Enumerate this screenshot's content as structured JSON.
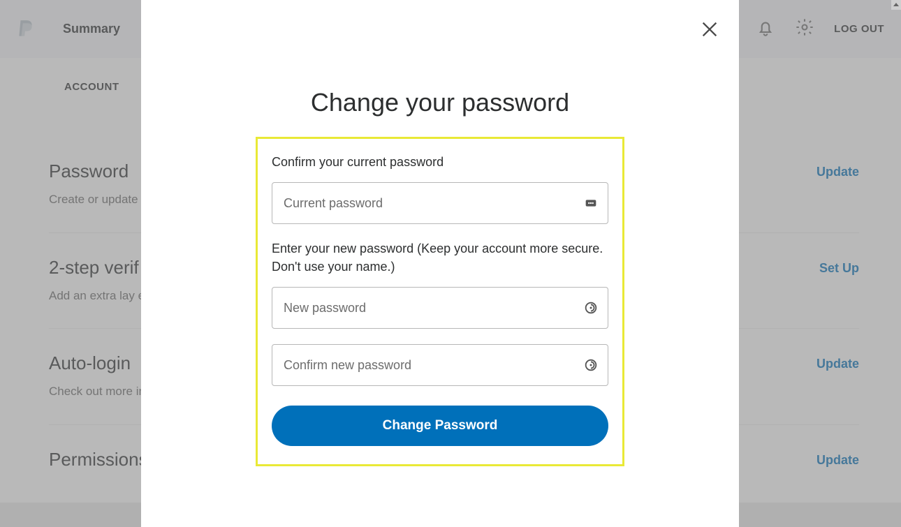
{
  "header": {
    "nav_summary": "Summary",
    "logout": "LOG OUT"
  },
  "subnav": {
    "account": "ACCOUNT"
  },
  "sections": {
    "password": {
      "title": "Password",
      "desc": "Create or update",
      "action": "Update"
    },
    "twostep": {
      "title": "2-step verif",
      "desc": "Add an extra lay\neach time you lo",
      "action": "Set Up"
    },
    "autologin": {
      "title": "Auto-login",
      "desc": "Check out more\nincluding One To",
      "action": "Update"
    },
    "permissions": {
      "title": "Permissions",
      "action": "Update"
    }
  },
  "modal": {
    "title": "Change your password",
    "confirm_label": "Confirm your current password",
    "current_ph": "Current password",
    "enter_label": "Enter your new password (Keep your account more secure. Don't use your name.)",
    "new_ph": "New password",
    "confirm_new_ph": "Confirm new password",
    "button": "Change Password"
  }
}
